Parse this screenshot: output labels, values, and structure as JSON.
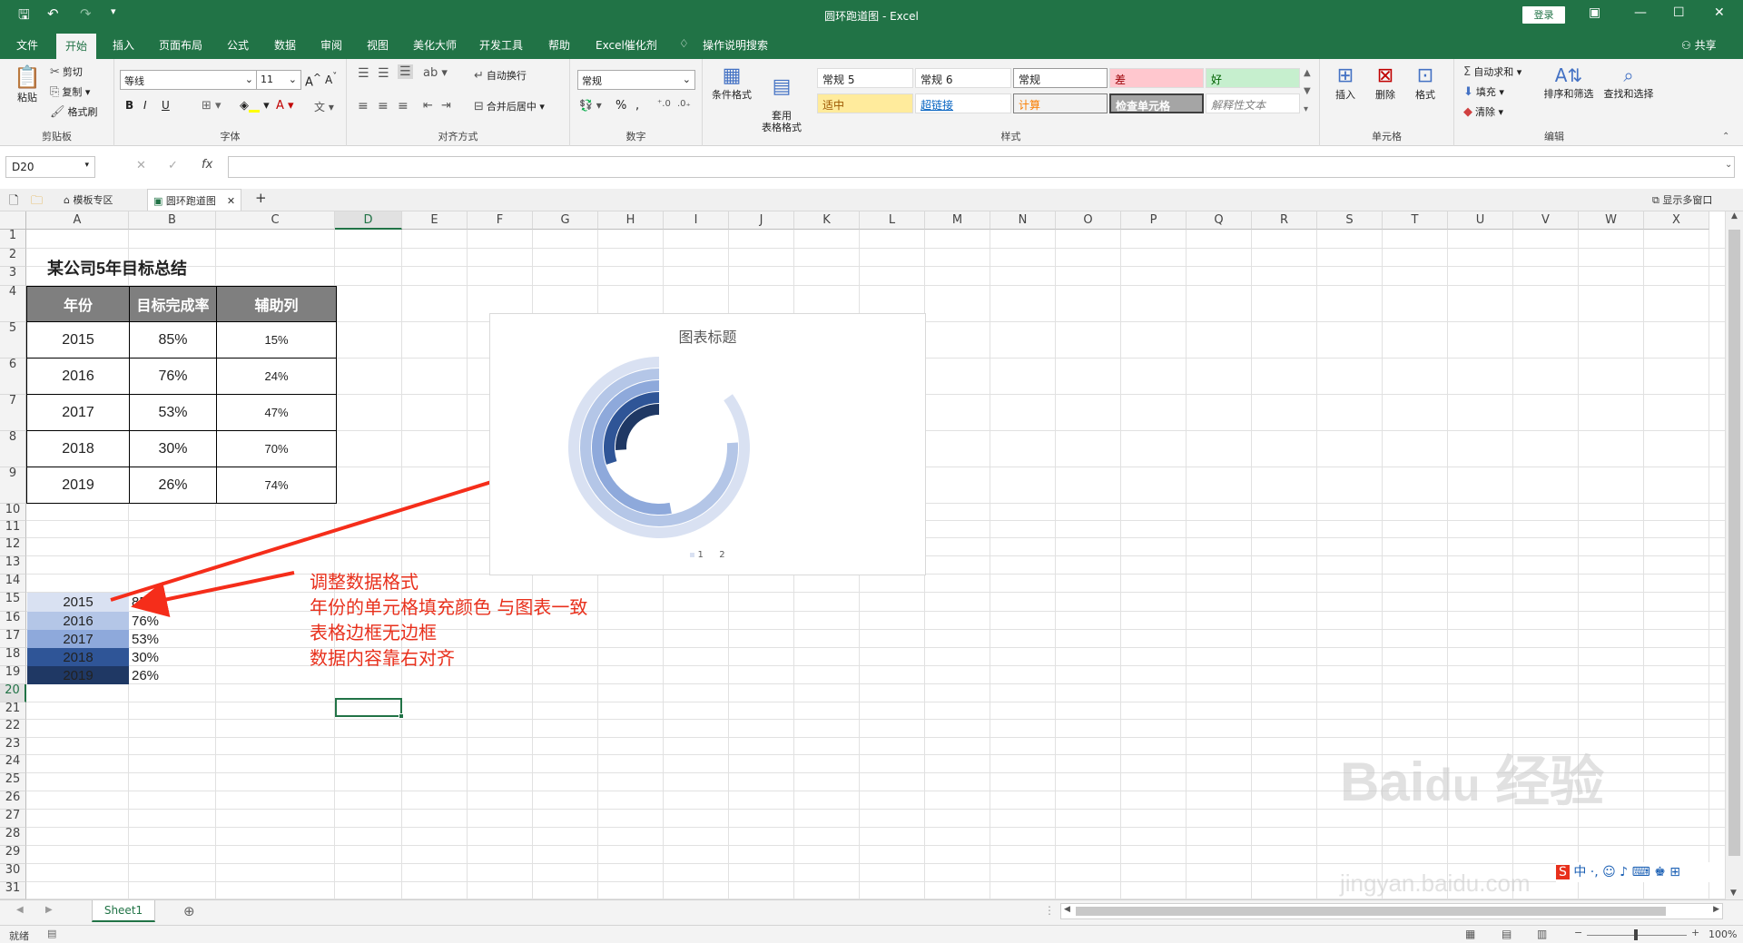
{
  "window": {
    "title": "圆环跑道图 - Excel",
    "login_label": "登录",
    "share_label": "共享"
  },
  "ribbon_tabs": [
    "文件",
    "开始",
    "插入",
    "页面布局",
    "公式",
    "数据",
    "审阅",
    "视图",
    "美化大师",
    "开发工具",
    "帮助",
    "Excel催化剂"
  ],
  "tell_me": "操作说明搜索",
  "clipboard": {
    "paste": "粘贴",
    "cut": "剪切",
    "copy": "复制",
    "format_painter": "格式刷",
    "label": "剪贴板"
  },
  "font": {
    "name": "等线",
    "size": "11",
    "label": "字体",
    "bold": "B",
    "italic": "I",
    "underline": "U"
  },
  "alignment": {
    "wrap": "自动换行",
    "merge": "合并后居中",
    "label": "对齐方式"
  },
  "number": {
    "format": "常规",
    "label": "数字",
    "percent": "%",
    "comma": ","
  },
  "styles": {
    "conditional": "条件格式",
    "table_format": "套用\n表格格式",
    "cells": [
      "常规 5",
      "常规 6",
      "常规",
      "差",
      "好",
      "适中",
      "超链接",
      "计算",
      "检查单元格",
      "解释性文本"
    ],
    "label": "样式"
  },
  "cells_group": {
    "insert": "插入",
    "delete": "删除",
    "format": "格式",
    "label": "单元格"
  },
  "editing": {
    "autosum": "自动求和",
    "fill": "填充",
    "clear": "清除",
    "sort": "排序和筛选",
    "find": "查找和选择",
    "label": "编辑"
  },
  "formula": {
    "name_box": "D20",
    "fx": "fx",
    "value": ""
  },
  "doc_tabs": {
    "tab1": "模板专区",
    "tab2": "圆环跑道图",
    "show_windows": "显示多窗口"
  },
  "columns": [
    "A",
    "B",
    "C",
    "D",
    "E",
    "F",
    "G",
    "H",
    "I",
    "J",
    "K",
    "L",
    "M",
    "N",
    "O",
    "P",
    "Q",
    "R",
    "S",
    "T",
    "U",
    "V",
    "W",
    "X"
  ],
  "rows": [
    "1",
    "2",
    "3",
    "4",
    "5",
    "6",
    "7",
    "8",
    "9",
    "10",
    "11",
    "12",
    "13",
    "14",
    "15",
    "16",
    "17",
    "18",
    "19",
    "20",
    "21",
    "22",
    "23",
    "24",
    "25",
    "26",
    "27",
    "28",
    "29",
    "30",
    "31"
  ],
  "table": {
    "title": "某公司5年目标总结",
    "headers": [
      "年份",
      "目标完成率",
      "辅助列"
    ],
    "rows": [
      [
        "2015",
        "85%",
        "15%"
      ],
      [
        "2016",
        "76%",
        "24%"
      ],
      [
        "2017",
        "53%",
        "47%"
      ],
      [
        "2018",
        "30%",
        "70%"
      ],
      [
        "2019",
        "26%",
        "74%"
      ]
    ]
  },
  "formatted_rows": [
    {
      "year": "2015",
      "value": "85%",
      "color": "#d9e1f2"
    },
    {
      "year": "2016",
      "value": "76%",
      "color": "#b4c6e7"
    },
    {
      "year": "2017",
      "value": "53%",
      "color": "#8ea9db"
    },
    {
      "year": "2018",
      "value": "30%",
      "color": "#2f5597"
    },
    {
      "year": "2019",
      "value": "26%",
      "color": "#1f3864"
    }
  ],
  "annotation": [
    "调整数据格式",
    "年份的单元格填充颜色 与图表一致",
    "表格边框无边框",
    "数据内容靠右对齐"
  ],
  "chart_data": {
    "type": "doughnut",
    "title": "图表标题",
    "categories": [
      "2015",
      "2016",
      "2017",
      "2018",
      "2019"
    ],
    "series": [
      {
        "name": "1",
        "values": [
          0.85,
          0.76,
          0.53,
          0.3,
          0.26
        ]
      },
      {
        "name": "2",
        "values": [
          0.15,
          0.24,
          0.47,
          0.7,
          0.74
        ]
      }
    ],
    "ring_colors": [
      "#d9e1f2",
      "#b4c6e7",
      "#8ea9db",
      "#2f5597",
      "#1f3864"
    ],
    "legend": [
      "1",
      "2"
    ],
    "legend_position": "bottom"
  },
  "sheet_tab": "Sheet1",
  "status": {
    "ready": "就绪",
    "zoom": "100%"
  },
  "watermark": "Baidu 经验 jingyan.baidu.com"
}
